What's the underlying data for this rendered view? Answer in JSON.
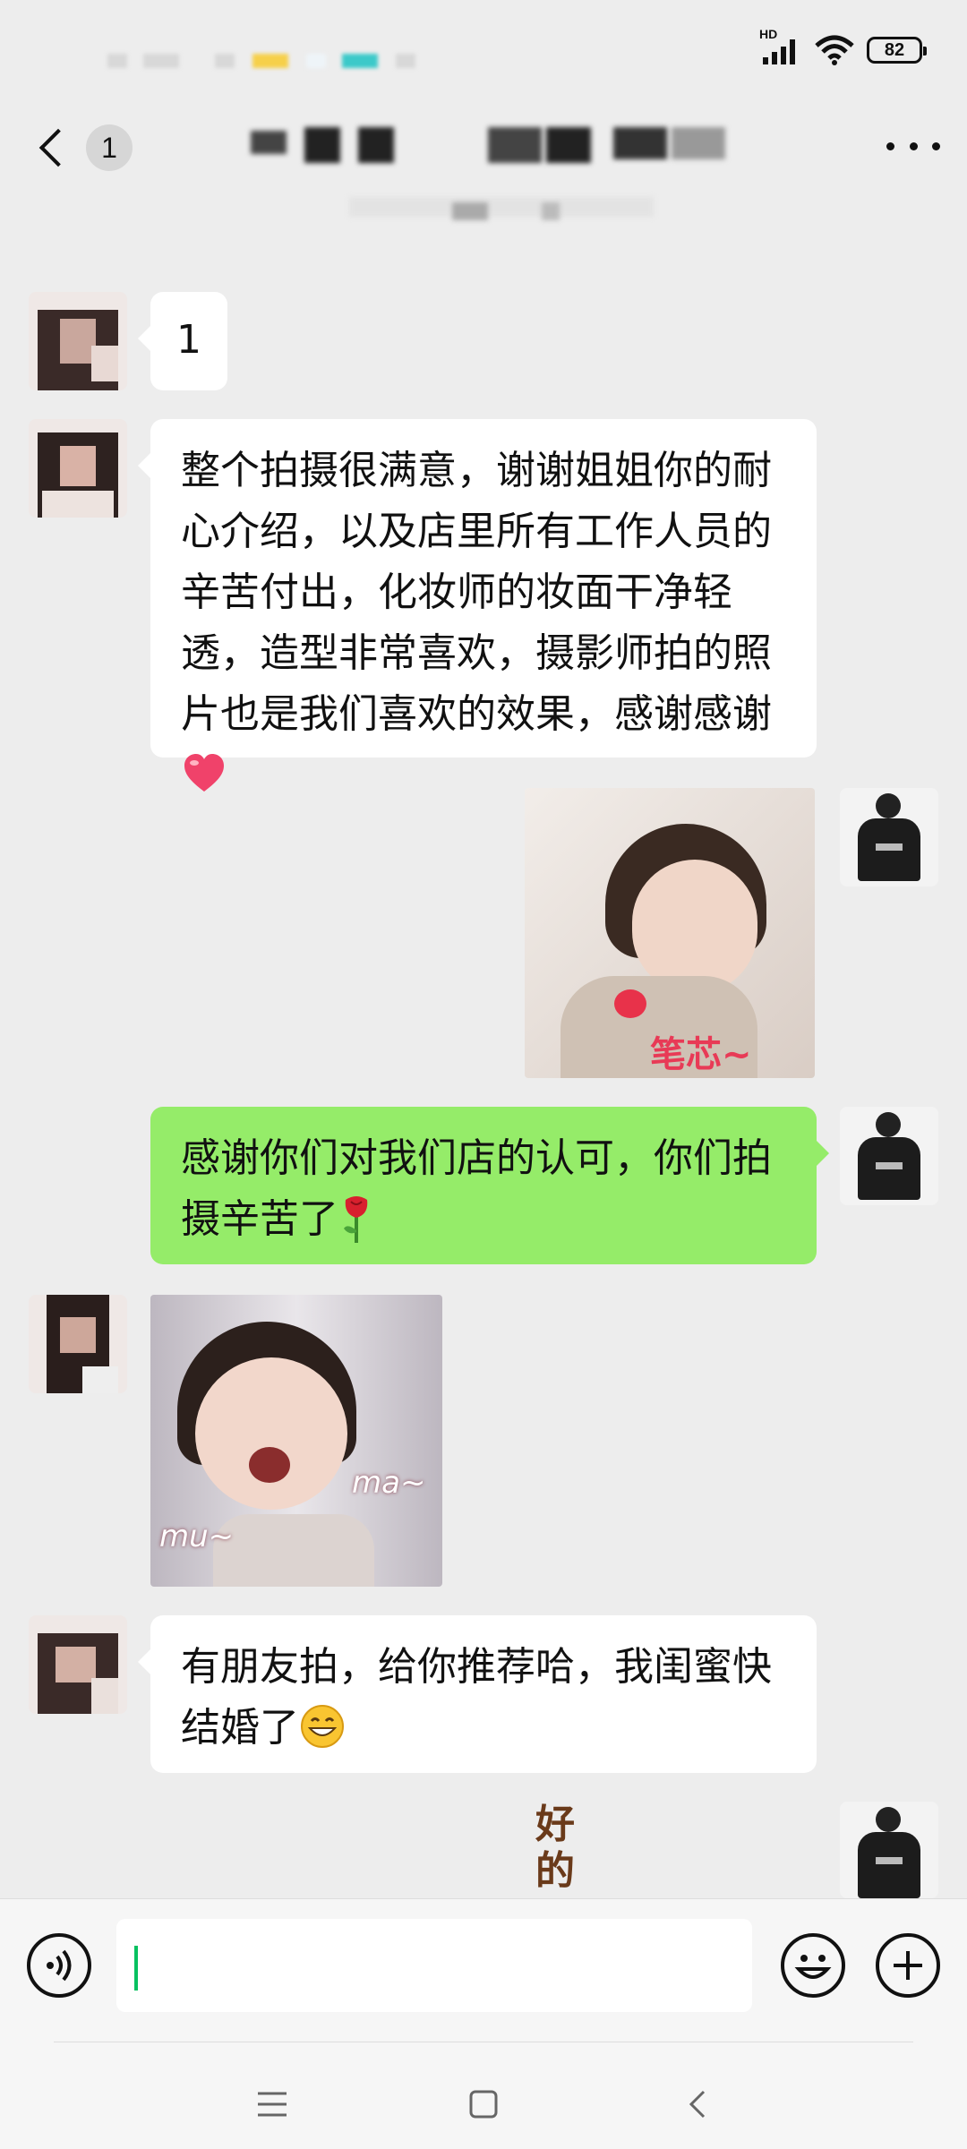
{
  "status_bar": {
    "network_label": "HD",
    "battery": "82"
  },
  "header": {
    "unread_badge": "1"
  },
  "messages": [
    {
      "side": "left",
      "type": "text",
      "text": "1"
    },
    {
      "side": "left",
      "type": "text",
      "text": "整个拍摄很满意，谢谢姐姐你的耐心介绍，以及店里所有工作人员的辛苦付出，化妆师的妆面干净轻透，造型非常喜欢，摄影师拍的照片也是我们喜欢的效果，感谢感谢"
    },
    {
      "side": "right",
      "type": "sticker",
      "caption": "笔芯~"
    },
    {
      "side": "right",
      "type": "text",
      "text": "感谢你们对我们店的认可，你们拍摄辛苦了"
    },
    {
      "side": "left",
      "type": "sticker",
      "caption_left": "mu~",
      "caption_right": "ma~"
    },
    {
      "side": "left",
      "type": "text",
      "text": "有朋友拍，给你推荐哈，我闺蜜快结婚了"
    },
    {
      "side": "right",
      "type": "sticker",
      "caption": "好的"
    }
  ],
  "input_bar": {
    "voice_icon": "voice-icon",
    "emoji_icon": "emoji-icon",
    "plus_icon": "plus-icon"
  },
  "colors": {
    "background": "#ededed",
    "bubble_self": "#95ec69",
    "bubble_other": "#ffffff",
    "caret": "#07c160"
  }
}
